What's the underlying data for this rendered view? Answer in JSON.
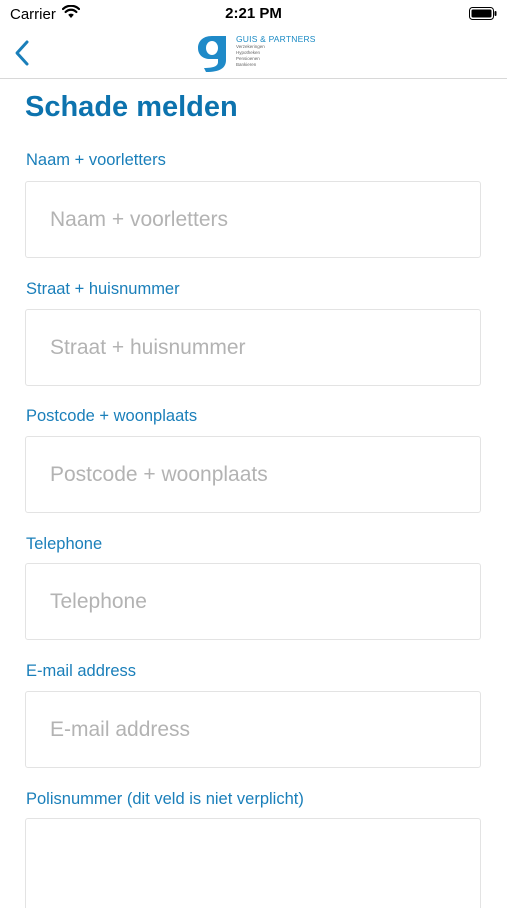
{
  "status_bar": {
    "carrier": "Carrier",
    "time": "2:21 PM"
  },
  "nav": {
    "back_icon": "chevron-left-icon",
    "logo": {
      "name": "GUIS & PARTNERS",
      "lines": [
        "Verzekeringen",
        "Hypotheken",
        "Pensioenen",
        "Bankieren"
      ]
    }
  },
  "colors": {
    "accent": "#1a7fba",
    "title": "#0d73ae",
    "placeholder": "#b3b3b3",
    "border": "#e3e3e3"
  },
  "form": {
    "title": "Schade melden",
    "fields": [
      {
        "label": "Naam + voorletters",
        "placeholder": "Naam + voorletters",
        "value": ""
      },
      {
        "label": "Straat + huisnummer",
        "placeholder": "Straat + huisnummer",
        "value": ""
      },
      {
        "label": "Postcode + woonplaats",
        "placeholder": "Postcode + woonplaats",
        "value": ""
      },
      {
        "label": "Telephone",
        "placeholder": "Telephone",
        "value": ""
      },
      {
        "label": "E-mail address",
        "placeholder": "E-mail address",
        "value": ""
      },
      {
        "label": "Polisnummer (dit veld is niet verplicht)",
        "placeholder": "",
        "value": ""
      }
    ]
  }
}
